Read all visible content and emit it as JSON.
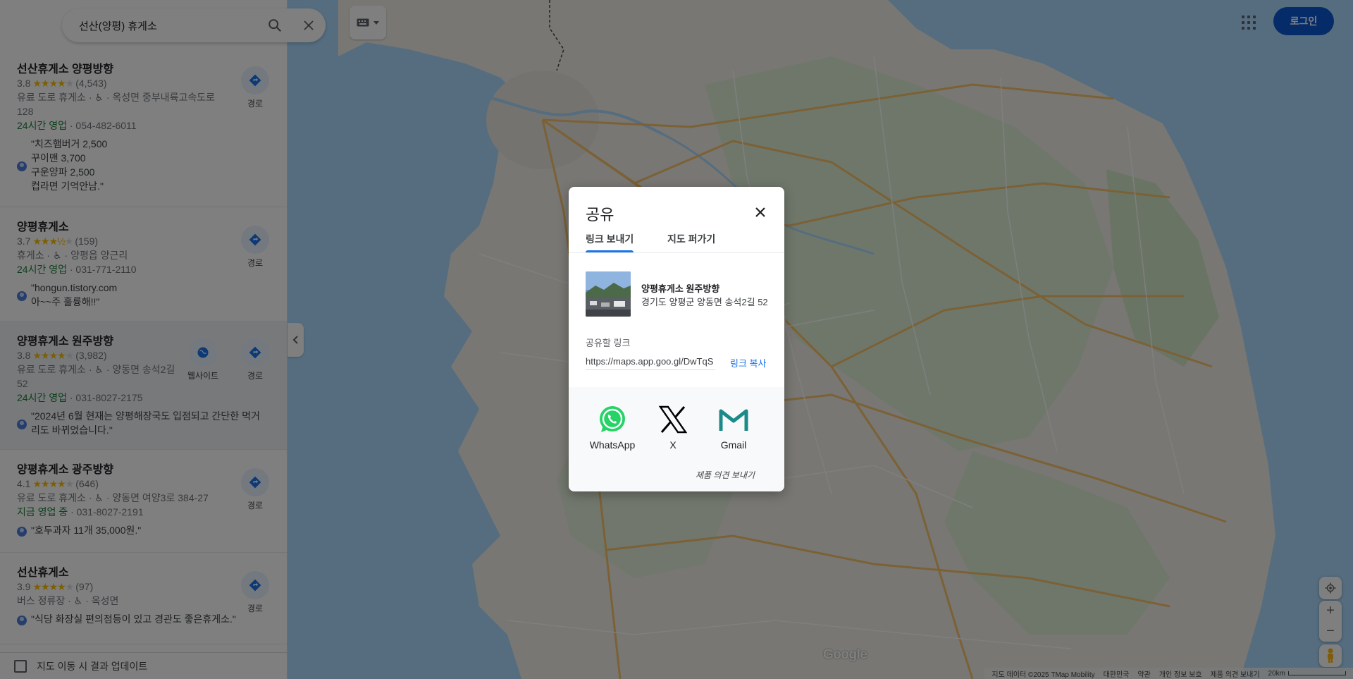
{
  "search": {
    "query": "선산(양평) 휴게소"
  },
  "results": [
    {
      "name": "선산휴게소 양평방향",
      "rating": "3.8",
      "stars": 4,
      "reviews": "(4,543)",
      "category": "유료 도로 휴게소 ·",
      "address": "· 옥성면 중부내륙고속도로",
      "address2": "128",
      "hours": "24시간 영업",
      "phone": "· 054-482-6011",
      "review_lines": [
        "\"치즈햄버거 2,500",
        "꾸이맨 3,700",
        "구운양파 2,500",
        "컵라면 기억안남.\""
      ],
      "actions": [
        "경로"
      ]
    },
    {
      "name": "양평휴게소",
      "rating": "3.7",
      "stars": 3.5,
      "reviews": "(159)",
      "category": "휴게소 ·",
      "address": "· 양평읍 양근리",
      "hours": "24시간 영업",
      "phone": "· 031-771-2110",
      "review_lines": [
        "\"hongun.tistory.com",
        "아~~주 훌륭해!!\""
      ],
      "actions": [
        "경로"
      ]
    },
    {
      "name": "양평휴게소 원주방향",
      "rating": "3.8",
      "stars": 4,
      "reviews": "(3,982)",
      "category": "유료 도로 휴게소 ·",
      "address": "· 양동면 송석2길",
      "address2": "52",
      "hours": "24시간 영업",
      "phone": "· 031-8027-2175",
      "review_lines": [
        "\"2024년 6월 현재는 양평해장국도 입점되고 간단한 먹거",
        "리도 바뀌었습니다.\""
      ],
      "actions": [
        "웹사이트",
        "경로"
      ]
    },
    {
      "name": "양평휴게소 광주방향",
      "rating": "4.1",
      "stars": 4,
      "reviews": "(646)",
      "category": "유료 도로 휴게소 ·",
      "address": "· 양동면 여양3로 384-27",
      "hours": "지금 영업 중",
      "phone": "· 031-8027-2191",
      "review_lines": [
        "\"호두과자 11개 35,000원.\""
      ],
      "actions": [
        "경로"
      ]
    },
    {
      "name": "선산휴게소",
      "rating": "3.9",
      "stars": 4,
      "reviews": "(97)",
      "category": "버스 정류장 ·",
      "address": "· 옥성면",
      "review_lines": [
        "\"식당 화장실 편의점등이 있고 경관도 좋은휴게소.\""
      ],
      "actions": [
        "경로"
      ]
    }
  ],
  "bottom_checkbox": "지도 이동 시 결과 업데이트",
  "header": {
    "login": "로그인"
  },
  "map": {
    "logo": "Google",
    "footer": [
      "지도 데이터 ©2025 TMap Mobility",
      "대한민국",
      "약관",
      "개인 정보 보호",
      "제품 의견 보내기"
    ],
    "scale": "20km"
  },
  "dialog": {
    "title": "공유",
    "tabs": [
      "링크 보내기",
      "지도 퍼가기"
    ],
    "place_name": "양평휴게소 원주방향",
    "place_address": "경기도 양평군 양동면 송석2길 52",
    "link_label": "공유할 링크",
    "link_value": "https://maps.app.goo.gl/DwTqS",
    "copy": "링크 복사",
    "share": [
      "WhatsApp",
      "X",
      "Gmail"
    ],
    "feedback": "제품 의견 보내기"
  },
  "colors": {
    "accent": "#1a73e8",
    "open": "#188038",
    "star": "#fbbc04",
    "login_bg": "#0b57d0",
    "whatsapp": "#25d366",
    "gmail": "#1c8a8a"
  }
}
